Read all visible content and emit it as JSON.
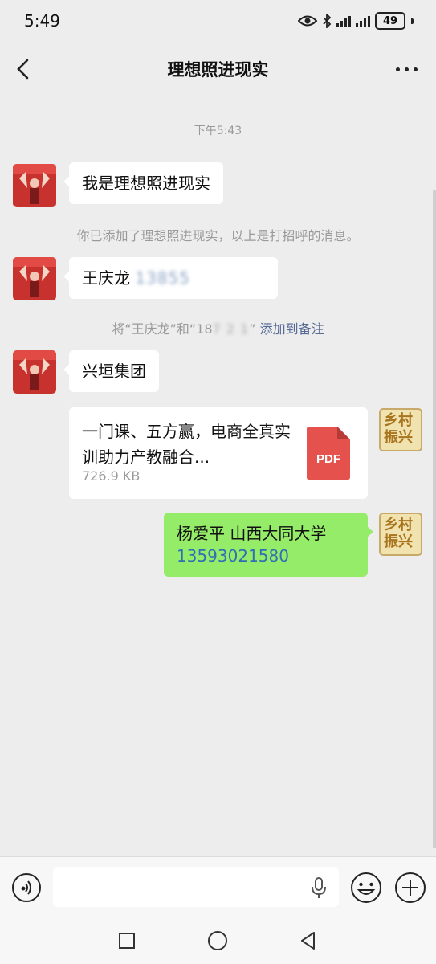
{
  "status_bar": {
    "time": "5:49",
    "battery": "49"
  },
  "header": {
    "title": "理想照进现实"
  },
  "chat": {
    "timestamp": "下午5:43",
    "messages": {
      "greeting": "我是理想照进现实",
      "system_added": "你已添加了理想照进现实，以上是打招呼的消息。",
      "contact_name": "王庆龙",
      "contact_phone_blurred": "138‭5‬5",
      "system_remark_prefix": "将“王庆龙”和“18",
      "system_remark_blurred": "7 2 1",
      "system_remark_suffix": "”",
      "system_remark_link": "添加到备注",
      "company": "兴垣集团",
      "file_title": "一门课、五方赢，电商全真实训助力产教融合...",
      "file_size": "726.9 KB",
      "file_badge": "PDF",
      "sent_line1": "杨爱平 山西大同大学",
      "sent_phone": "13593021580"
    },
    "self_avatar_text": [
      "乡村",
      "振兴"
    ]
  },
  "colors": {
    "sent_bubble": "#95ec69",
    "link": "#576b95",
    "pdf_red": "#e5514c"
  }
}
